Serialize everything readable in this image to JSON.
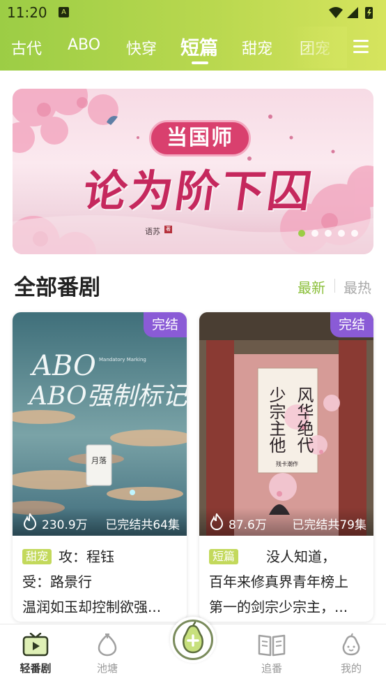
{
  "status_bar": {
    "time": "11:20",
    "notif_icon": "A"
  },
  "tabs": [
    {
      "label": "古代"
    },
    {
      "label": "ABO"
    },
    {
      "label": "快穿"
    },
    {
      "label": "短篇",
      "active": true
    },
    {
      "label": "甜宠"
    },
    {
      "label": "团宠"
    }
  ],
  "banner": {
    "subtitle": "当国师",
    "title": "论为阶下囚",
    "author": "语苏",
    "seal": "著",
    "page_count": 5,
    "active_page": 1
  },
  "section": {
    "title": "全部番剧",
    "sort_new": "最新",
    "sort_hot": "最热"
  },
  "cards": [
    {
      "badge": "完结",
      "views": "230.9万",
      "episodes": "已完结共64集",
      "cover_title": "ABO强制标记",
      "cover_en": "Mandatory Marking",
      "cover_author": "月落",
      "tag": "甜宠",
      "desc_lines": [
        "攻：程钰",
        "受：路景行",
        "温润如玉却控制欲强..."
      ]
    },
    {
      "badge": "完结",
      "views": "87.6万",
      "episodes": "已完结共79集",
      "cover_title_col1": "风华绝代",
      "cover_title_col2": "少宗主他",
      "cover_author": "残卡潮作",
      "tag": "短篇",
      "desc_lines": [
        "没人知道，",
        "百年来修真界青年榜上",
        "第一的剑宗少宗主，..."
      ]
    }
  ],
  "bottom_nav": [
    {
      "label": "轻番剧",
      "icon": "tv-icon",
      "active": true
    },
    {
      "label": "池塘",
      "icon": "pond-icon"
    },
    {
      "label": "",
      "icon": "pear-add-icon"
    },
    {
      "label": "追番",
      "icon": "book-icon"
    },
    {
      "label": "我的",
      "icon": "pear-face-icon"
    }
  ],
  "colors": {
    "accent": "#9ccd45",
    "badge": "#8a5bd6",
    "tag": "#c3d95c",
    "sort_active": "#8bbf3a"
  }
}
